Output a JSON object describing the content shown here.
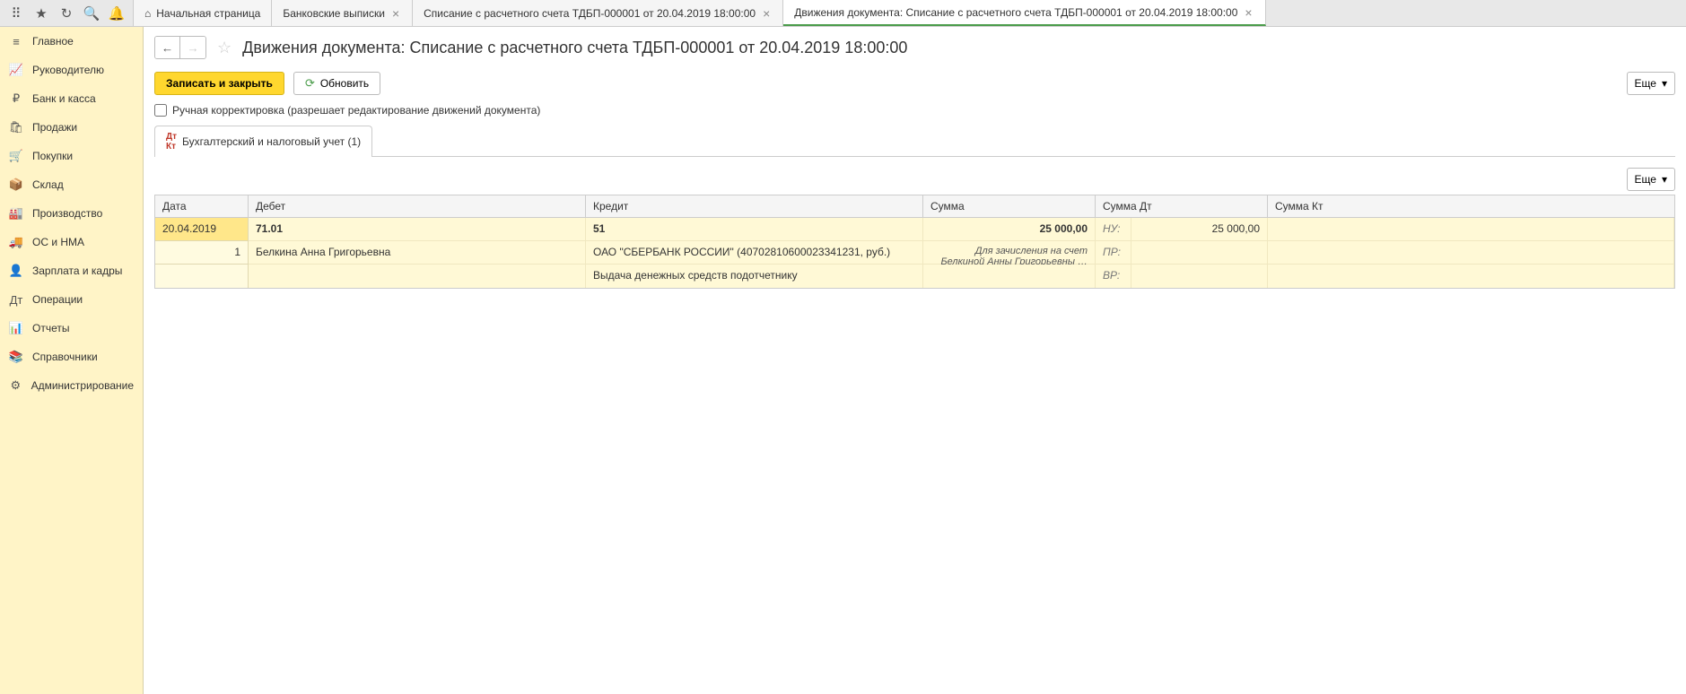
{
  "topbar": {
    "tabs": [
      {
        "label": "Начальная страница",
        "closeable": false,
        "home": true
      },
      {
        "label": "Банковские выписки",
        "closeable": true
      },
      {
        "label": "Списание с расчетного счета ТДБП-000001 от 20.04.2019 18:00:00",
        "closeable": true
      },
      {
        "label": "Движения документа: Списание с расчетного счета ТДБП-000001 от 20.04.2019 18:00:00",
        "closeable": true,
        "active": true
      }
    ]
  },
  "sidebar": {
    "items": [
      {
        "icon": "≡",
        "label": "Главное"
      },
      {
        "icon": "📈",
        "label": "Руководителю"
      },
      {
        "icon": "₽",
        "label": "Банк и касса"
      },
      {
        "icon": "🛍",
        "label": "Продажи"
      },
      {
        "icon": "🛒",
        "label": "Покупки"
      },
      {
        "icon": "📦",
        "label": "Склад"
      },
      {
        "icon": "🏭",
        "label": "Производство"
      },
      {
        "icon": "🚚",
        "label": "ОС и НМА"
      },
      {
        "icon": "👤",
        "label": "Зарплата и кадры"
      },
      {
        "icon": "Дт",
        "label": "Операции"
      },
      {
        "icon": "📊",
        "label": "Отчеты"
      },
      {
        "icon": "📚",
        "label": "Справочники"
      },
      {
        "icon": "⚙",
        "label": "Администрирование"
      }
    ]
  },
  "page": {
    "title": "Движения документа: Списание с расчетного счета ТДБП-000001 от 20.04.2019 18:00:00"
  },
  "toolbar": {
    "save_close": "Записать и закрыть",
    "refresh": "Обновить",
    "more": "Еще"
  },
  "checkbox": {
    "manual_edit": "Ручная корректировка (разрешает редактирование движений документа)"
  },
  "formtab": {
    "label": "Бухгалтерский и налоговый учет (1)"
  },
  "grid": {
    "more": "Еще",
    "headers": {
      "date": "Дата",
      "debit": "Дебет",
      "credit": "Кредит",
      "sum": "Сумма",
      "sumdt": "Сумма Дт",
      "sumkt": "Сумма Кт"
    },
    "row": {
      "date": "20.04.2019",
      "num": "1",
      "debit_account": "71.01",
      "credit_account": "51",
      "sum": "25 000,00",
      "tax_nu_label": "НУ:",
      "tax_nu_value": "25 000,00",
      "debit_subject": "Белкина Анна Григорьевна",
      "credit_subject": "ОАО \"СБЕРБАНК РОССИИ\" (40702810600023341231, руб.)",
      "description": "Для зачисления на счет Белкиной Анны Григорьевны …",
      "tax_pr_label": "ПР:",
      "credit_operation": "Выдача денежных средств подотчетнику",
      "tax_vr_label": "ВР:"
    }
  }
}
